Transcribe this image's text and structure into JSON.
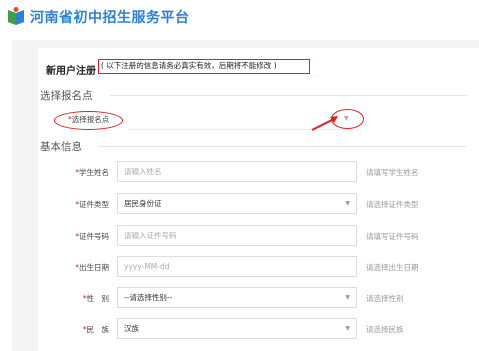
{
  "header": {
    "title": "河南省初中招生服务平台",
    "logo_icon": "book-logo-icon"
  },
  "registration": {
    "title": "新用户注册",
    "notice": "( 以下注册的信息请务必真实有效，后期将不能修改 )"
  },
  "sections": {
    "select_site": "选择报名点",
    "basic_info": "基本信息"
  },
  "site_select": {
    "required_mark": "*",
    "label": "选择报名点",
    "value": ""
  },
  "form_rows": [
    {
      "required": "*",
      "label": "学生姓名",
      "value": "请输入姓名",
      "is_placeholder": true,
      "is_select": false,
      "hint": "请填写学生姓名"
    },
    {
      "required": "*",
      "label": "证件类型",
      "value": "居民身份证",
      "is_placeholder": false,
      "is_select": true,
      "hint": "请选择证件类型"
    },
    {
      "required": "*",
      "label": "证件号码",
      "value": "请输入证件号码",
      "is_placeholder": true,
      "is_select": false,
      "hint": "请填写证件号码"
    },
    {
      "required": "*",
      "label": "出生日期",
      "value": "yyyy-MM-dd",
      "is_placeholder": true,
      "is_select": false,
      "hint": "请选择出生日期"
    },
    {
      "required": "*",
      "label": "性　别",
      "value": "--请选择性别--",
      "is_placeholder": false,
      "is_select": true,
      "hint": "请选择性别"
    },
    {
      "required": "*",
      "label": "民　族",
      "value": "汉族",
      "is_placeholder": false,
      "is_select": true,
      "hint": "请选择民族"
    }
  ],
  "colors": {
    "brand_blue": "#2d7fd8",
    "annotation_red": "#e02020"
  }
}
